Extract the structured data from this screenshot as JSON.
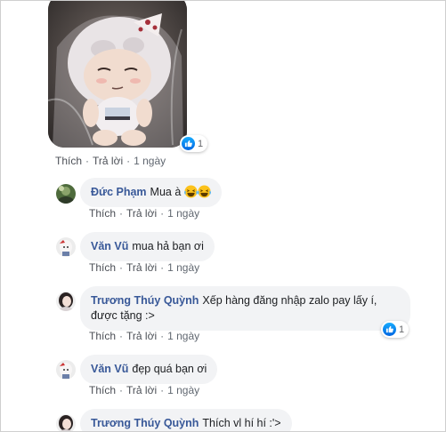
{
  "post": {
    "like_label": "Thích",
    "reply_label": "Trả lời",
    "time": "1 ngày",
    "reaction_count": "1"
  },
  "comments": [
    {
      "name": "Đức Phạm",
      "text": "Mua à",
      "emoji": "laughing-face",
      "like": "Thích",
      "reply": "Trả lời",
      "time": "1 ngày"
    },
    {
      "name": "Văn Vũ",
      "text": "mua hả bạn ơi",
      "like": "Thích",
      "reply": "Trả lời",
      "time": "1 ngày"
    },
    {
      "name": "Trương Thúy Quỳnh",
      "text": "Xếp hàng đăng nhập zalo pay lấy í, được tặng :>",
      "like": "Thích",
      "reply": "Trả lời",
      "time": "1 ngày",
      "reaction_count": "1"
    },
    {
      "name": "Văn Vũ",
      "text": "đẹp quá bạn ơi",
      "like": "Thích",
      "reply": "Trả lời",
      "time": "1 ngày"
    },
    {
      "name": "Trương Thúy Quỳnh",
      "text": "Thích vl hí hí :'>"
    }
  ],
  "colors": {
    "name_link": "#385898",
    "bubble_bg": "#f2f3f5",
    "like_blue": "#0165e1"
  }
}
